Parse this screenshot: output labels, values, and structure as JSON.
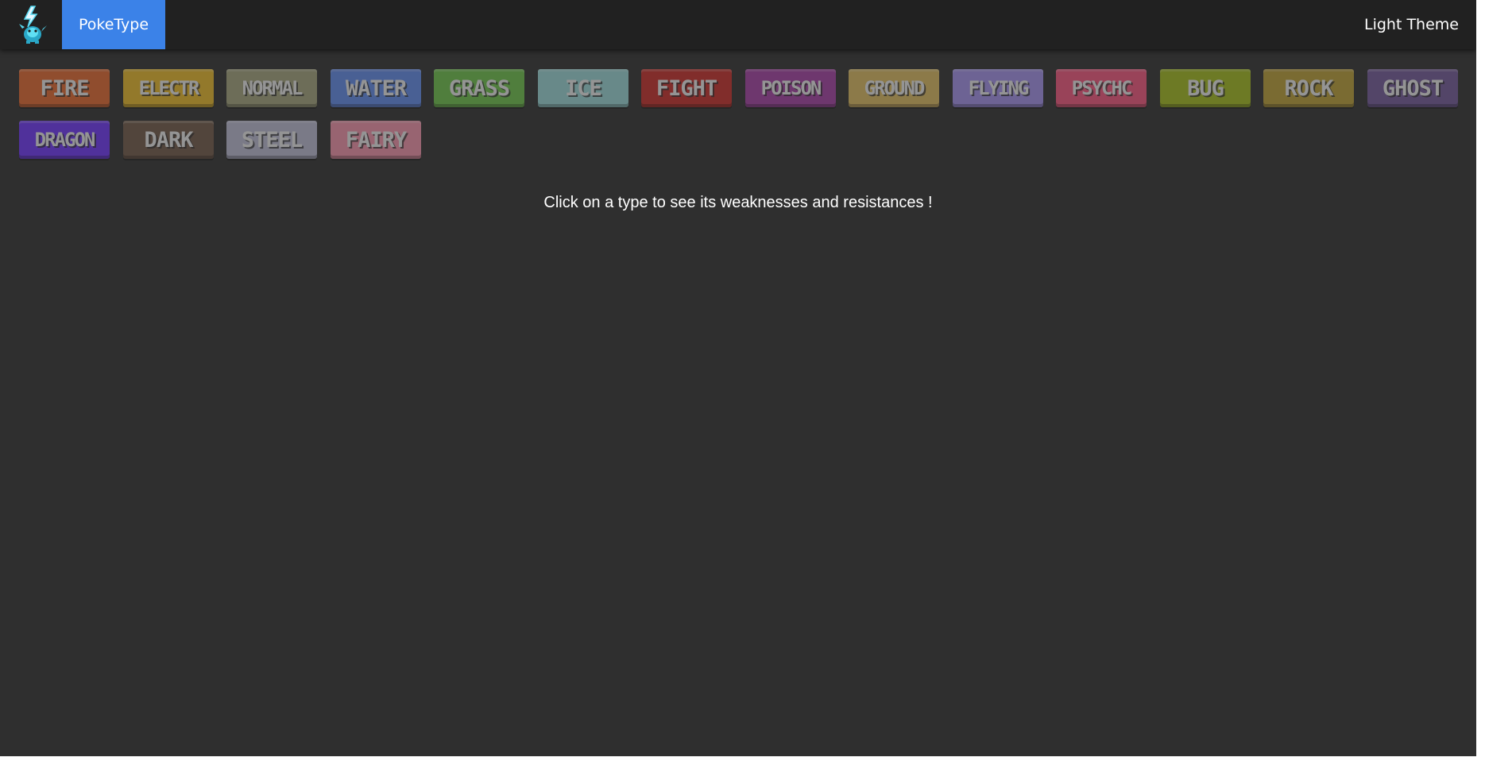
{
  "navbar": {
    "brand": "PokeType",
    "theme_toggle": "Light Theme",
    "brand_color": "#3b82e8"
  },
  "types": [
    {
      "label": "FIRE",
      "color": "#e0662e"
    },
    {
      "label": "ELECTR",
      "color": "#e6b628"
    },
    {
      "label": "NORMAL",
      "color": "#a0a07a"
    },
    {
      "label": "WATER",
      "color": "#6088e8"
    },
    {
      "label": "GRASS",
      "color": "#6cbf4a"
    },
    {
      "label": "ICE",
      "color": "#98d4d4"
    },
    {
      "label": "FIGHT",
      "color": "#c42c28"
    },
    {
      "label": "POISON",
      "color": "#a33ea3"
    },
    {
      "label": "GROUND",
      "color": "#d8b860"
    },
    {
      "label": "FLYING",
      "color": "#a08ee8"
    },
    {
      "label": "PSYCHC",
      "color": "#f0547c"
    },
    {
      "label": "BUG",
      "color": "#a0b81e"
    },
    {
      "label": "ROCK",
      "color": "#b89c36"
    },
    {
      "label": "GHOST",
      "color": "#715898"
    },
    {
      "label": "DRAGON",
      "color": "#6c34f4"
    },
    {
      "label": "DARK",
      "color": "#705848"
    },
    {
      "label": "STEEL",
      "color": "#b8b8d0"
    },
    {
      "label": "FAIRY",
      "color": "#ee90a8"
    }
  ],
  "hint_text": "Click on a type to see its weaknesses and resistances !"
}
